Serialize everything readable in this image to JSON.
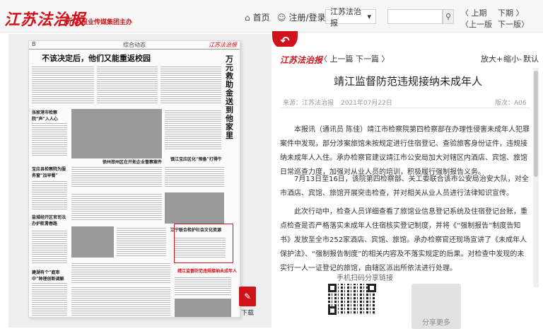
{
  "header": {
    "logo": "江苏法治报",
    "logo_sub_brand": "新华",
    "logo_sub": "报业传媒集团主办",
    "home_icon": "home-icon",
    "home": "首页",
    "user_icon": "user-icon",
    "login": "注册/登录",
    "paper_select": "江苏法治报",
    "search_placeholder": "",
    "search_icon": "search-icon",
    "prev_issue": "上期",
    "next_issue": "下期",
    "prev_page": "上一版",
    "next_page": "下一版"
  },
  "newspaper": {
    "section_letter": "B",
    "section": "综合动态",
    "masthead": "江苏法治报",
    "headline_main": "不该决定后，他们又能重返校园",
    "vertical_headline": "万元救助金送到他家里",
    "headlines": [
      "张家港市检察院“声”入人心",
      "徐州邳州区在开拓企业督察案件",
      "靖江市检察院防范违规接纳未成年人",
      "宝应县检察院为服务窗“加早餐”",
      "盐城经开区官司法办护航青春路",
      "镇江宝应区化“预备”打得牛",
      "江宁联合检护社会文化资源",
      "建湖有个“庭审中”种理创新调解",
      "靖江监督防范违规接纳未成年人"
    ],
    "download_label": "下载"
  },
  "article": {
    "source_logo": "江苏法治报",
    "prev": "上一篇",
    "next": "下一篇",
    "zoom_in": "放大+",
    "zoom_out": "缩小-",
    "reset": "默认",
    "title": "靖江监督防范违规接纳未成年人",
    "source": "来源：江苏法治报",
    "date": "2021年07月22日",
    "page": "版次：A06",
    "paragraphs": [
      "本报讯（通讯员 陈佳）靖江市检察院第四检察部在办理性侵害未成年人犯罪案件中发现，部分涉案旅馆未按规定进行住宿登记、查验旅客身份证件，违规接纳未成年人入住。承办检察官建议靖江市公安局加大对辖区内酒店、宾馆、旅馆日常巡查力度，加强对从业人员的培训，积极履行强制报告义务。",
      "7月13日至16日，该院第四检察部、关工委联合该市公安局治安大队，对全市酒店、宾馆、旅馆开展突击检查，并对相关从业人员进行法律知识宣传。",
      "此次行动中，检查人员详细查看了旅馆业信息登记系统及住宿登记台账，重点检查是否严格落实未成年人住宿核实登记制度，并将《“强制报告”制度告知书》发放至全市252家酒店、宾馆、旅馆。承办检察官还现场宣讲了《未成年人保护法》、“强制报告制度”的相关内容及不落实规定的后果。对检查中发现的未实行一人一证登记的旅馆，由辖区派出所依法进行处理。"
    ],
    "share": "手机扫码分享链接",
    "phone_label": "分享更多"
  },
  "colors": {
    "brand_red": "#d0121b"
  }
}
